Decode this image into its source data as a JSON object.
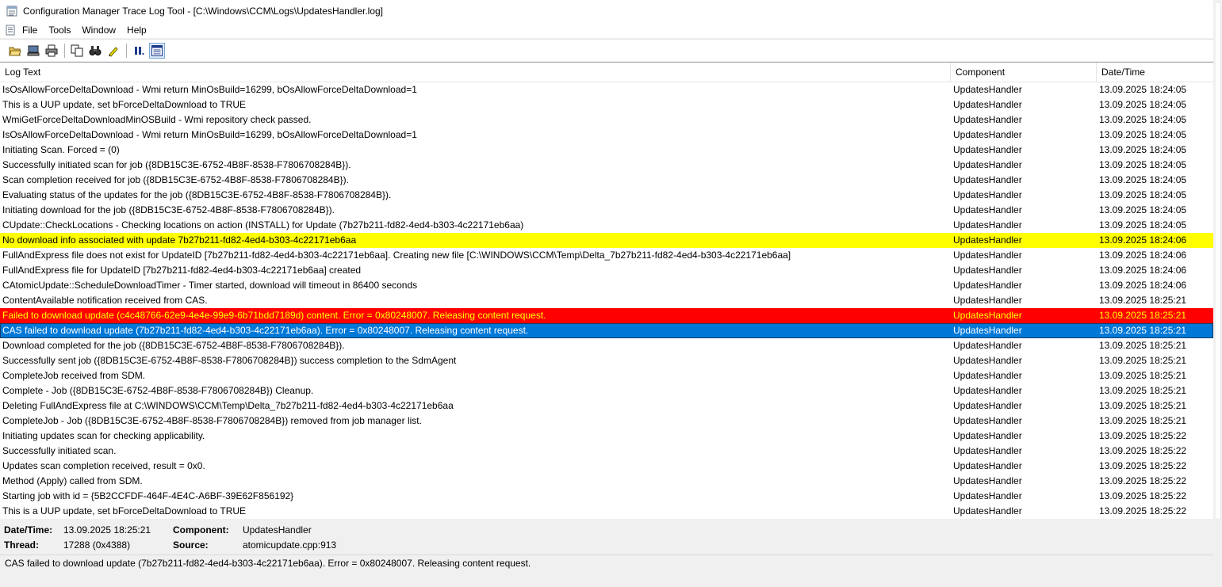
{
  "window": {
    "title": "Configuration Manager Trace Log Tool - [C:\\Windows\\CCM\\Logs\\UpdatesHandler.log]"
  },
  "menu": [
    "File",
    "Tools",
    "Window",
    "Help"
  ],
  "toolbar": {
    "buttons": [
      "open-folder-icon",
      "computer-icon",
      "print-icon",
      "copy-icon",
      "find-icon",
      "highlight-icon",
      "pause-icon",
      "error-lookup-icon"
    ]
  },
  "list": {
    "headers": {
      "text": "Log Text",
      "component": "Component",
      "date": "Date/Time"
    },
    "rows": [
      {
        "text": "IsOsAllowForceDeltaDownload - Wmi return  MinOsBuild=16299, bOsAllowForceDeltaDownload=1",
        "component": "UpdatesHandler",
        "date": "13.09.2025 18:24:05",
        "state": "normal"
      },
      {
        "text": "This is a UUP update, set bForceDeltaDownload to TRUE",
        "component": "UpdatesHandler",
        "date": "13.09.2025 18:24:05",
        "state": "normal"
      },
      {
        "text": "WmiGetForceDeltaDownloadMinOSBuild - Wmi repository check passed.",
        "component": "UpdatesHandler",
        "date": "13.09.2025 18:24:05",
        "state": "normal"
      },
      {
        "text": "IsOsAllowForceDeltaDownload - Wmi return  MinOsBuild=16299, bOsAllowForceDeltaDownload=1",
        "component": "UpdatesHandler",
        "date": "13.09.2025 18:24:05",
        "state": "normal"
      },
      {
        "text": "Initiating Scan. Forced = (0)",
        "component": "UpdatesHandler",
        "date": "13.09.2025 18:24:05",
        "state": "normal"
      },
      {
        "text": "Successfully initiated scan for job ({8DB15C3E-6752-4B8F-8538-F7806708284B}).",
        "component": "UpdatesHandler",
        "date": "13.09.2025 18:24:05",
        "state": "normal"
      },
      {
        "text": "Scan completion received for job ({8DB15C3E-6752-4B8F-8538-F7806708284B}).",
        "component": "UpdatesHandler",
        "date": "13.09.2025 18:24:05",
        "state": "normal"
      },
      {
        "text": "Evaluating status of the updates for the job ({8DB15C3E-6752-4B8F-8538-F7806708284B}).",
        "component": "UpdatesHandler",
        "date": "13.09.2025 18:24:05",
        "state": "normal"
      },
      {
        "text": "Initiating download for the job ({8DB15C3E-6752-4B8F-8538-F7806708284B}).",
        "component": "UpdatesHandler",
        "date": "13.09.2025 18:24:05",
        "state": "normal"
      },
      {
        "text": "CUpdate::CheckLocations - Checking locations on action (INSTALL) for Update (7b27b211-fd82-4ed4-b303-4c22171eb6aa)",
        "component": "UpdatesHandler",
        "date": "13.09.2025 18:24:05",
        "state": "normal"
      },
      {
        "text": "No download info associated with update 7b27b211-fd82-4ed4-b303-4c22171eb6aa",
        "component": "UpdatesHandler",
        "date": "13.09.2025 18:24:06",
        "state": "warn"
      },
      {
        "text": "FullAndExpress file does not exist for UpdateID [7b27b211-fd82-4ed4-b303-4c22171eb6aa]. Creating new file [C:\\WINDOWS\\CCM\\Temp\\Delta_7b27b211-fd82-4ed4-b303-4c22171eb6aa]",
        "component": "UpdatesHandler",
        "date": "13.09.2025 18:24:06",
        "state": "normal"
      },
      {
        "text": "FullAndExpress file for UpdateID [7b27b211-fd82-4ed4-b303-4c22171eb6aa] created",
        "component": "UpdatesHandler",
        "date": "13.09.2025 18:24:06",
        "state": "normal"
      },
      {
        "text": "CAtomicUpdate::ScheduleDownloadTimer - Timer started, download will timeout in 86400 seconds",
        "component": "UpdatesHandler",
        "date": "13.09.2025 18:24:06",
        "state": "normal"
      },
      {
        "text": "ContentAvailable notification received from CAS.",
        "component": "UpdatesHandler",
        "date": "13.09.2025 18:25:21",
        "state": "normal"
      },
      {
        "text": "Failed to download update (c4c48766-62e9-4e4e-99e9-6b71bdd7189d) content. Error = 0x80248007. Releasing content request.",
        "component": "UpdatesHandler",
        "date": "13.09.2025 18:25:21",
        "state": "err"
      },
      {
        "text": "CAS failed to download update (7b27b211-fd82-4ed4-b303-4c22171eb6aa). Error = 0x80248007. Releasing content request.",
        "component": "UpdatesHandler",
        "date": "13.09.2025 18:25:21",
        "state": "sel"
      },
      {
        "text": "Download completed for the job ({8DB15C3E-6752-4B8F-8538-F7806708284B}).",
        "component": "UpdatesHandler",
        "date": "13.09.2025 18:25:21",
        "state": "normal"
      },
      {
        "text": "Successfully sent job ({8DB15C3E-6752-4B8F-8538-F7806708284B}) success completion to the SdmAgent",
        "component": "UpdatesHandler",
        "date": "13.09.2025 18:25:21",
        "state": "normal"
      },
      {
        "text": "CompleteJob received from SDM.",
        "component": "UpdatesHandler",
        "date": "13.09.2025 18:25:21",
        "state": "normal"
      },
      {
        "text": "Complete - Job ({8DB15C3E-6752-4B8F-8538-F7806708284B}) Cleanup.",
        "component": "UpdatesHandler",
        "date": "13.09.2025 18:25:21",
        "state": "normal"
      },
      {
        "text": "Deleting FullAndExpress file at C:\\WINDOWS\\CCM\\Temp\\Delta_7b27b211-fd82-4ed4-b303-4c22171eb6aa",
        "component": "UpdatesHandler",
        "date": "13.09.2025 18:25:21",
        "state": "normal"
      },
      {
        "text": "CompleteJob - Job ({8DB15C3E-6752-4B8F-8538-F7806708284B}) removed from job manager list.",
        "component": "UpdatesHandler",
        "date": "13.09.2025 18:25:21",
        "state": "normal"
      },
      {
        "text": "Initiating updates scan for checking applicability.",
        "component": "UpdatesHandler",
        "date": "13.09.2025 18:25:22",
        "state": "normal"
      },
      {
        "text": "Successfully initiated scan.",
        "component": "UpdatesHandler",
        "date": "13.09.2025 18:25:22",
        "state": "normal"
      },
      {
        "text": "Updates scan completion received, result = 0x0.",
        "component": "UpdatesHandler",
        "date": "13.09.2025 18:25:22",
        "state": "normal"
      },
      {
        "text": "Method (Apply) called from SDM.",
        "component": "UpdatesHandler",
        "date": "13.09.2025 18:25:22",
        "state": "normal"
      },
      {
        "text": "Starting job with id = {5B2CCFDF-464F-4E4C-A6BF-39E62F856192}",
        "component": "UpdatesHandler",
        "date": "13.09.2025 18:25:22",
        "state": "normal"
      },
      {
        "text": "This is a UUP update, set bForceDeltaDownload to TRUE",
        "component": "UpdatesHandler",
        "date": "13.09.2025 18:25:22",
        "state": "normal"
      }
    ]
  },
  "details": {
    "datetime_label": "Date/Time:",
    "datetime_value": "13.09.2025 18:25:21",
    "component_label": "Component:",
    "component_value": "UpdatesHandler",
    "thread_label": "Thread:",
    "thread_value": "17288 (0x4388)",
    "source_label": "Source:",
    "source_value": "atomicupdate.cpp:913",
    "message": "CAS failed to download update (7b27b211-fd82-4ed4-b303-4c22171eb6aa). Error = 0x80248007. Releasing content request."
  },
  "colors": {
    "warning_row": "#ffff00",
    "error_row": "#ff0000",
    "error_text": "#ffff00",
    "selected_row": "#0078d7"
  }
}
